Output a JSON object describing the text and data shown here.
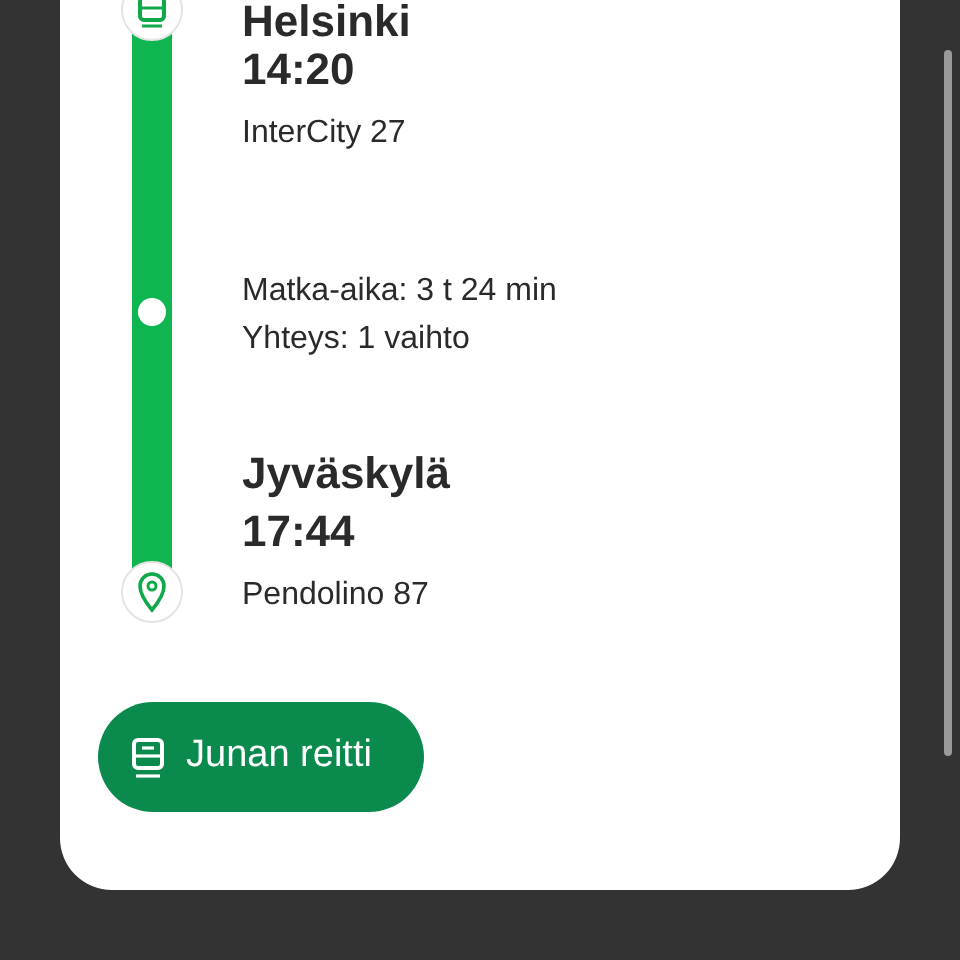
{
  "stops": [
    {
      "name": "Helsinki",
      "time": "14:20",
      "train": "InterCity 27"
    },
    {
      "name": "Jyväskylä",
      "time": "17:44",
      "train": "Pendolino 87"
    }
  ],
  "journey": {
    "duration": "Matka-aika: 3 t 24 min",
    "connections": "Yhteys: 1 vaihto"
  },
  "route_button": {
    "label": "Junan reitti"
  }
}
